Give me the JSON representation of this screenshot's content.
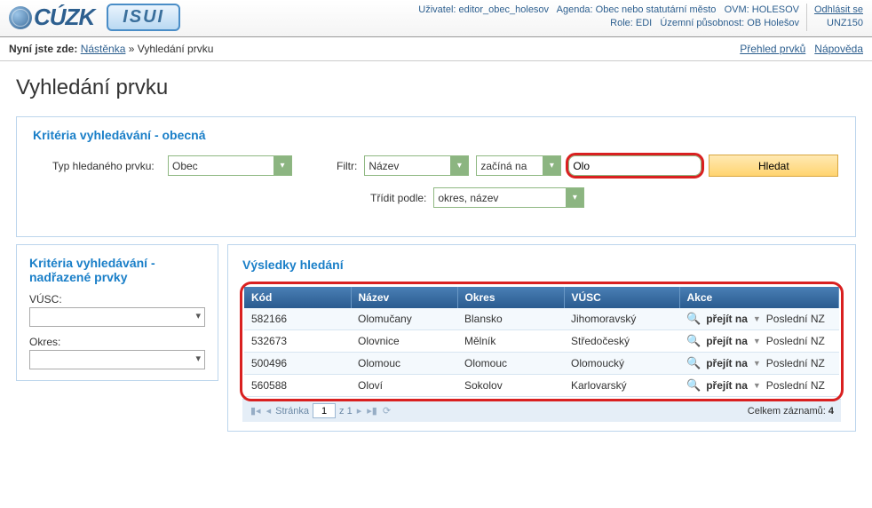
{
  "header": {
    "brand_cuzk": "ÚZK",
    "brand_c": "C",
    "brand_isui": "ISUI",
    "user_label": "Uživatel:",
    "user_value": "editor_obec_holesov",
    "agenda_label": "Agenda:",
    "agenda_value": "Obec nebo statutární město",
    "ovm_label": "OVM:",
    "ovm_value": "HOLESOV",
    "role_label": "Role:",
    "role_value": "EDI",
    "uzemni_label": "Územní působnost:",
    "uzemni_value": "OB Holešov",
    "logout": "Odhlásit se",
    "unz": "UNZ150"
  },
  "breadcrumb": {
    "label": "Nyní jste zde:",
    "item1": "Nástěnka",
    "sep": "»",
    "item2": "Vyhledání prvku",
    "link_right1": "Přehled prvků",
    "link_right2": "Nápověda"
  },
  "page_title": "Vyhledání prvku",
  "criteria_general": {
    "title": "Kritéria vyhledávání - obecná",
    "typ_label": "Typ hledaného prvku:",
    "typ_value": "Obec",
    "filtr_label": "Filtr:",
    "filtr_field": "Název",
    "filtr_op": "začíná na",
    "filtr_value": "Olo",
    "search_btn": "Hledat",
    "sort_label": "Třídit podle:",
    "sort_value": "okres, název"
  },
  "criteria_side": {
    "title": "Kritéria vyhledávání - nadřazené prvky",
    "vusc_label": "VÚSC:",
    "vusc_value": "",
    "okres_label": "Okres:",
    "okres_value": ""
  },
  "results": {
    "title": "Výsledky hledání",
    "columns": {
      "kod": "Kód",
      "nazev": "Název",
      "okres": "Okres",
      "vusc": "VÚSC",
      "akce": "Akce"
    },
    "rows": [
      {
        "kod": "582166",
        "nazev": "Olomučany",
        "okres": "Blansko",
        "vusc": "Jihomoravský"
      },
      {
        "kod": "532673",
        "nazev": "Olovnice",
        "okres": "Mělník",
        "vusc": "Středočeský"
      },
      {
        "kod": "500496",
        "nazev": "Olomouc",
        "okres": "Olomouc",
        "vusc": "Olomoucký"
      },
      {
        "kod": "560588",
        "nazev": "Oloví",
        "okres": "Sokolov",
        "vusc": "Karlovarský"
      }
    ],
    "action_prejit": "přejít na",
    "action_posledni": "Poslední NZ"
  },
  "pager": {
    "label": "Stránka",
    "page": "1",
    "of_label": "z 1",
    "total_label": "Celkem záznamů:",
    "total": "4"
  }
}
